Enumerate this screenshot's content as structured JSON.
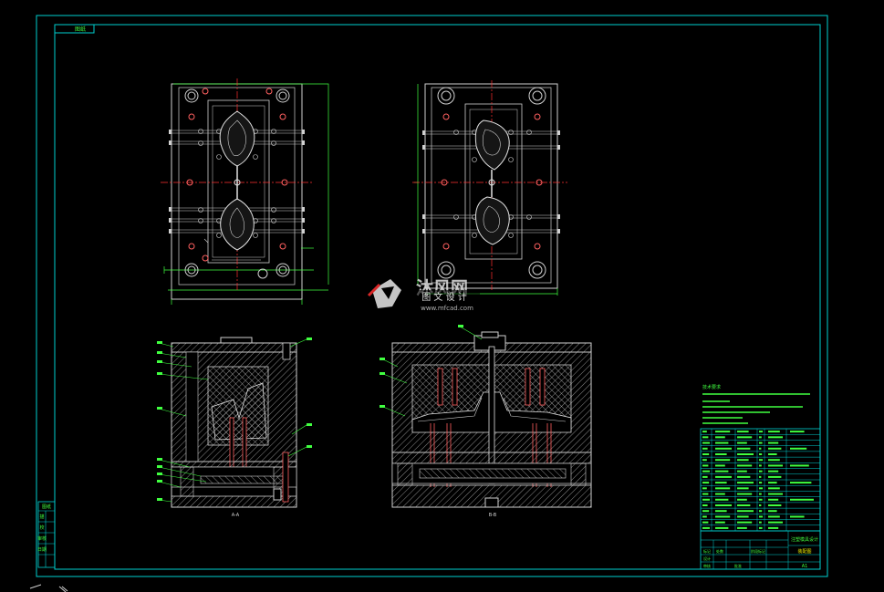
{
  "drawing": {
    "top_tag": "图纸",
    "left_table_rows": [
      "图纸",
      "描",
      "校",
      "审核",
      "日期"
    ],
    "view_labels": [
      "A-A",
      "B-B"
    ],
    "notes_title": "技术要求",
    "title_block": {
      "product": "注塑模具设计",
      "drawing_name": "装配图",
      "scale": "A1",
      "labels": [
        "标记",
        "处数",
        "分区",
        "更改文件号",
        "签名",
        "年月日",
        "设计",
        "标准化",
        "阶段标记",
        "重量",
        "比例",
        "审核",
        "工艺",
        "批准",
        "共",
        "张",
        "第",
        "张"
      ]
    },
    "bom_rows": 18
  },
  "watermark": {
    "brand": "沐风网",
    "subtitle": "图 文 设 计",
    "url": "www.mfcad.com"
  },
  "colors": {
    "background": "#000000",
    "frame": "#00d0d0",
    "mold_lines": "#d0d0d0",
    "center_lines": "#ff3030",
    "red_parts": "#ff6060",
    "green_lines": "#40ff40",
    "yellow": "#e8e800",
    "blue": "#4060ff"
  }
}
